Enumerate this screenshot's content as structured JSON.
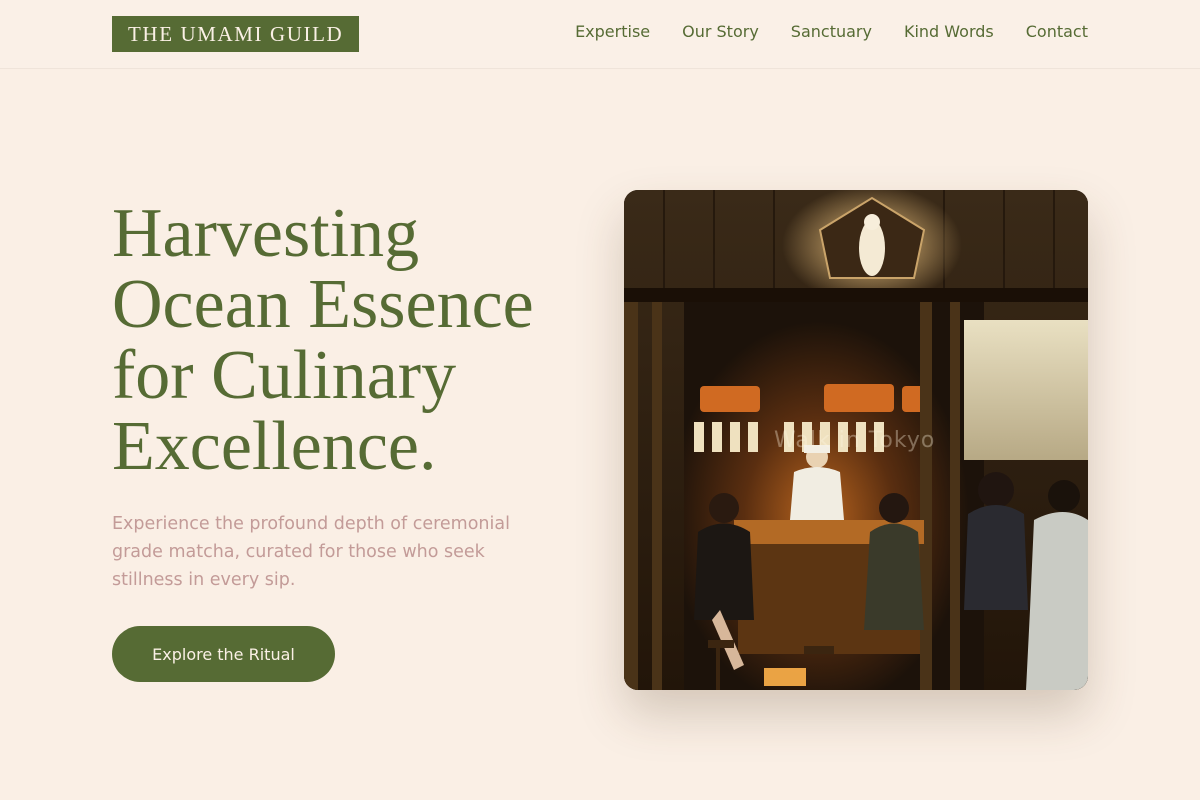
{
  "brand": {
    "name": "THE UMAMI GUILD",
    "accent_color": "#566b34",
    "background_color": "#faefe5",
    "subtext_color": "#c39b98"
  },
  "nav": {
    "items": [
      {
        "label": "Expertise"
      },
      {
        "label": "Our Story"
      },
      {
        "label": "Sanctuary"
      },
      {
        "label": "Kind Words"
      },
      {
        "label": "Contact"
      }
    ]
  },
  "hero": {
    "title": "Harvesting Ocean Essence for Culinary Excellence.",
    "subtitle": "Experience the profound depth of ceremonial grade matcha, curated for those who seek stillness in every sip.",
    "cta_label": "Explore the Ritual",
    "image": {
      "icon": "izakaya-interior-photo",
      "watermark": "Walk in Tokyo"
    }
  }
}
